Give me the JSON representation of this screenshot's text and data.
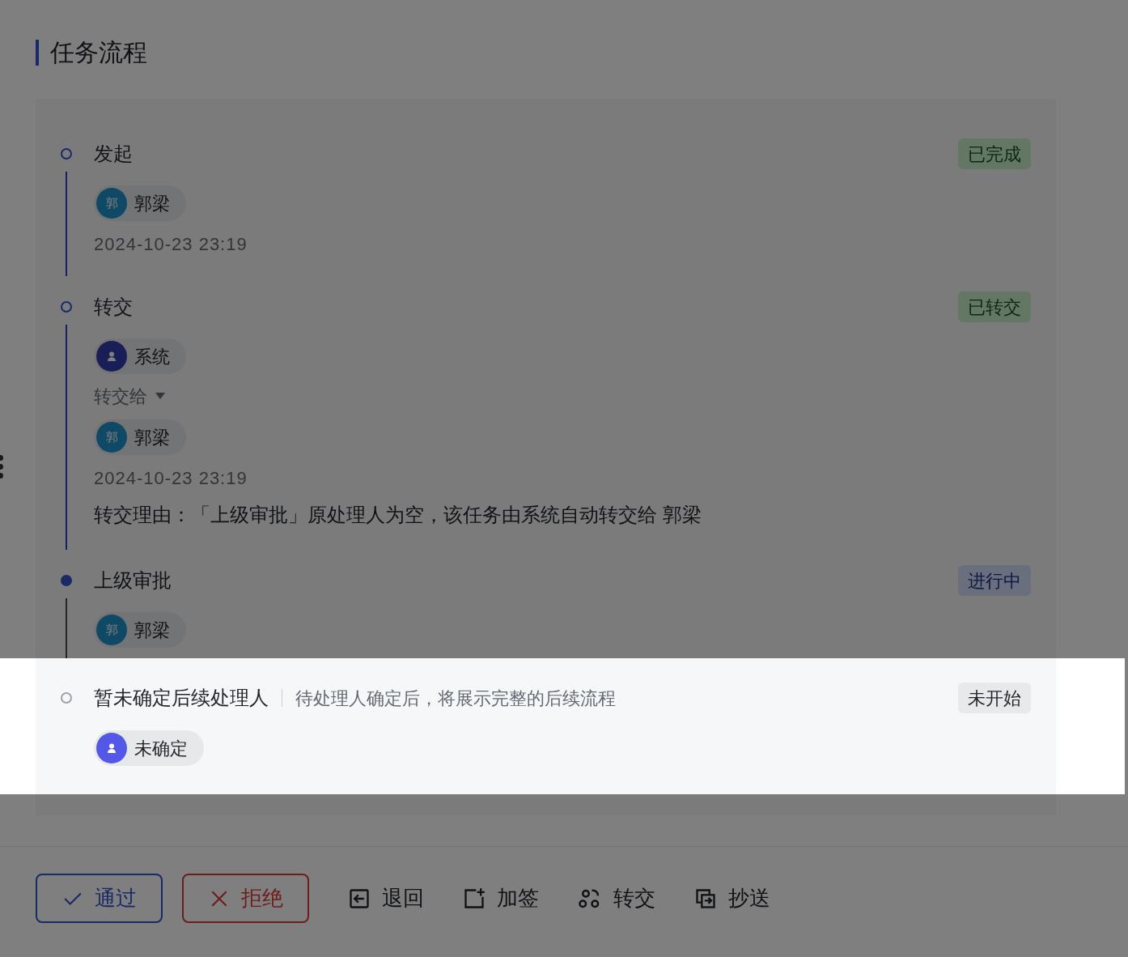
{
  "title": "任务流程",
  "steps": [
    {
      "name": "发起",
      "kind": "done",
      "highlighted": false,
      "status": {
        "label": "已完成",
        "kind": "success"
      },
      "items": [
        {
          "kind": "person",
          "avatar": {
            "kind": "initial",
            "text": "郭"
          },
          "name": "郭梁"
        },
        {
          "kind": "time",
          "text": "2024-10-23 23:19"
        }
      ]
    },
    {
      "name": "转交",
      "kind": "done",
      "highlighted": false,
      "status": {
        "label": "已转交",
        "kind": "success"
      },
      "items": [
        {
          "kind": "person",
          "avatar": {
            "kind": "system"
          },
          "name": "系统"
        },
        {
          "kind": "label",
          "text": "转交给"
        },
        {
          "kind": "person",
          "avatar": {
            "kind": "initial",
            "text": "郭"
          },
          "name": "郭梁"
        },
        {
          "kind": "time",
          "text": "2024-10-23 23:19"
        },
        {
          "kind": "note",
          "text": "转交理由：「上级审批」原处理人为空，该任务由系统自动转交给 郭梁"
        }
      ]
    },
    {
      "name": "上级审批",
      "kind": "current",
      "highlighted": false,
      "status": {
        "label": "进行中",
        "kind": "processing"
      },
      "items": [
        {
          "kind": "person",
          "avatar": {
            "kind": "initial",
            "text": "郭"
          },
          "name": "郭梁"
        }
      ]
    },
    {
      "name": "暂未确定后续处理人",
      "hint": "待处理人确定后，将展示完整的后续流程",
      "kind": "pending",
      "highlighted": true,
      "status": {
        "label": "未开始",
        "kind": "default"
      },
      "items": [
        {
          "kind": "person",
          "avatar": {
            "kind": "unknown"
          },
          "name": "未确定"
        }
      ]
    }
  ],
  "actions": [
    {
      "kind": "primary",
      "label": "通过"
    },
    {
      "kind": "danger",
      "label": "拒绝"
    },
    {
      "kind": "text",
      "label": "退回"
    },
    {
      "kind": "text",
      "label": "加签"
    },
    {
      "kind": "text",
      "label": "转交"
    },
    {
      "kind": "text",
      "label": "抄送"
    }
  ]
}
